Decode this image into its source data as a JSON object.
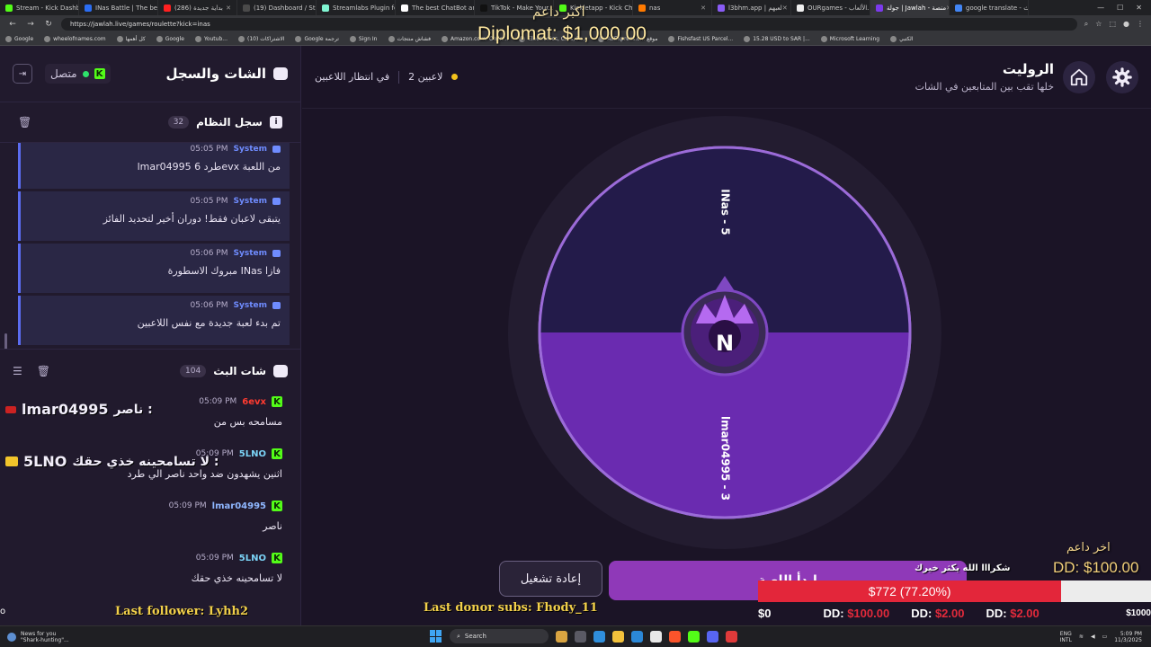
{
  "browser": {
    "tabs": [
      {
        "label": "Stream - Kick Dashb...",
        "color": "#53fc18",
        "active": false
      },
      {
        "label": "INas Battle | The best...",
        "color": "#2b6df2",
        "active": false
      },
      {
        "label": "(286) بداية جديدة",
        "color": "#ff2020",
        "active": false
      },
      {
        "label": "(19) Dashboard / Stre...",
        "color": "#4a4a4a",
        "active": false
      },
      {
        "label": "Streamlabs Plugin fo...",
        "color": "#80f5d2",
        "active": false
      },
      {
        "label": "The best ChatBot and...",
        "color": "#ffffff",
        "active": false
      },
      {
        "label": "TikTok - Make Your...",
        "color": "#111111",
        "active": false
      },
      {
        "label": "Kickletapp - Kick Ch...",
        "color": "#53fc18",
        "active": false
      },
      {
        "label": "nas",
        "color": "#ff7a00",
        "active": false
      },
      {
        "label": "l3bhm.app | لعبهم",
        "color": "#8a5cf6",
        "active": false
      },
      {
        "label": "OURgames - الألعاب...",
        "color": "#f0f0f0",
        "active": false
      },
      {
        "label": "جولة | Jawlah - منصة",
        "color": "#7c3aed",
        "active": true
      },
      {
        "label": "google translate - بحث...",
        "color": "#4285f4",
        "active": false
      }
    ],
    "url": "https://jawlah.live/games/roulette?kick=inas",
    "bookmarks": [
      "Google",
      "wheelofnames.com",
      "كل أهمها",
      "Google",
      "Youtub...",
      "الاشتراكات (10)",
      "Google ترجمة",
      "Sign In",
      "فشاش منتجات",
      "Amazon.com: Onlin...",
      "Electronics, Cars, Fa...",
      "AliExpress.c... موقع",
      "Fishsfast US Parcel...",
      "15.28 USD to SAR |...",
      "Microsoft Learning",
      "الكتبي"
    ]
  },
  "sidebar": {
    "title": "الشات والسجل",
    "status": "متصل",
    "system_log": {
      "title": "سجل النظام",
      "count": "32",
      "messages": [
        {
          "sender": "System",
          "time": "05:05 PM",
          "text": "lmar04995 طرد 6evx من اللعبة"
        },
        {
          "sender": "System",
          "time": "05:05 PM",
          "text": "يتبقى لاعبان فقط! دوران أخير لتحديد الفائز"
        },
        {
          "sender": "System",
          "time": "05:06 PM",
          "text": "مبروك الاسطورة INas فازا"
        },
        {
          "sender": "System",
          "time": "05:06 PM",
          "text": "تم بدء لعبة جديدة مع نفس اللاعبين"
        }
      ]
    },
    "stream_chat": {
      "title": "شات البث",
      "count": "104",
      "messages": [
        {
          "user": "6evx",
          "time": "05:09 PM",
          "color": "#ff3b30",
          "text": "مسامحه بس من",
          "tts_name": "lmar04995",
          "tts_text": "ناصر :"
        },
        {
          "user": "5LNO",
          "time": "05:09 PM",
          "color": "#7bd3f6",
          "text": "اثنين يشهدون ضد واحد ناصر الي طرد",
          "tts_name": "5LNO",
          "tts_text": "لا تسامحينه خذي حقك :"
        },
        {
          "user": "lmar04995",
          "time": "05:09 PM",
          "color": "#8fb7ff",
          "text": "ناصر"
        },
        {
          "user": "5LNO",
          "time": "05:09 PM",
          "color": "#7bd3f6",
          "text": "لا تسامحينه خذي حقك"
        }
      ]
    },
    "last_follower": "Last follower: Lyhh2"
  },
  "game": {
    "title": "الروليت",
    "subtitle": "خلها تقب بين المتابعين في الشات",
    "players": "2 لاعبين",
    "state": "في انتظار اللاعبين",
    "wheel_segments": [
      {
        "label": "INas - 5",
        "color": "#231b4a"
      },
      {
        "label": "lmar04995 - 3",
        "color": "#6a2bb0"
      }
    ],
    "center_letter": "N",
    "restart_label": "إعادة تشغيل",
    "spin_label": "إبدأ اللعبة"
  },
  "overlays": {
    "top_label": "اكبر داعم",
    "top_donor": "Diplomat: $1,000.00",
    "last_donor_label": "اخر داعم",
    "last_donor": "DD: $100.00",
    "thanks": "شكرااا الله يكثر خيرك",
    "goal_text": "$772 (77.20%)",
    "goal_progress": 0.772,
    "ticker": [
      {
        "prefix": "DD:",
        "amount": "$100.00"
      },
      {
        "prefix": "DD:",
        "amount": "$2.00"
      },
      {
        "prefix": "DD:",
        "amount": "$2.00"
      }
    ],
    "goal_start": "$0",
    "goal_end": "$1000",
    "last_donor_subs": "Last donor subs: Fhody_11"
  },
  "taskbar": {
    "weather_title": "News for you",
    "weather_sub": "\"Shark-hunting\"...",
    "search_placeholder": "Search",
    "lang": "ENG",
    "lang2": "INTL",
    "time": "5:09 PM",
    "date": "11/3/2025"
  }
}
